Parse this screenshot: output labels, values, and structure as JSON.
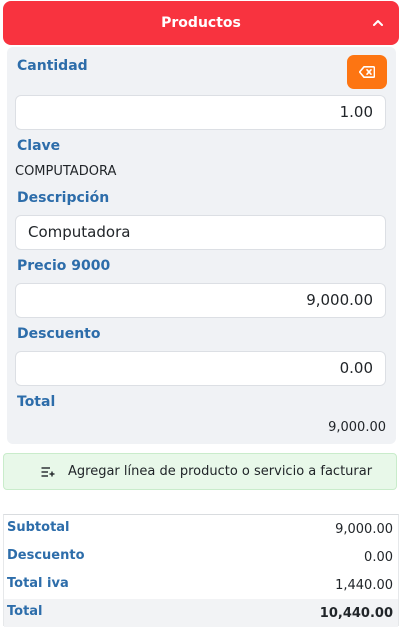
{
  "header": {
    "title": "Productos",
    "collapse_icon": "chevron-up-icon",
    "color": "#f8333f"
  },
  "product": {
    "cantidad_label": "Cantidad",
    "cantidad_value": "1.00",
    "clave_label": "Clave",
    "clave_value": "COMPUTADORA",
    "descripcion_label": "Descripción",
    "descripcion_value": "Computadora",
    "precio_label": "Precio 9000",
    "precio_value": "9,000.00",
    "descuento_label": "Descuento",
    "descuento_value": "0.00",
    "total_label": "Total",
    "total_value": "9,000.00",
    "clear_icon": "backspace-icon",
    "clear_color": "#fd7512"
  },
  "add_line": {
    "label": "Agregar línea de producto o servicio a facturar",
    "icon": "list-add-icon"
  },
  "totals": [
    {
      "label": "Subtotal",
      "value": "9,000.00"
    },
    {
      "label": "Descuento",
      "value": "0.00"
    },
    {
      "label": "Total iva",
      "value": "1,440.00"
    },
    {
      "label": "Total",
      "value": "10,440.00"
    }
  ],
  "colors": {
    "label_blue": "#2d6daa",
    "add_line_bg": "#e8f8e9"
  }
}
